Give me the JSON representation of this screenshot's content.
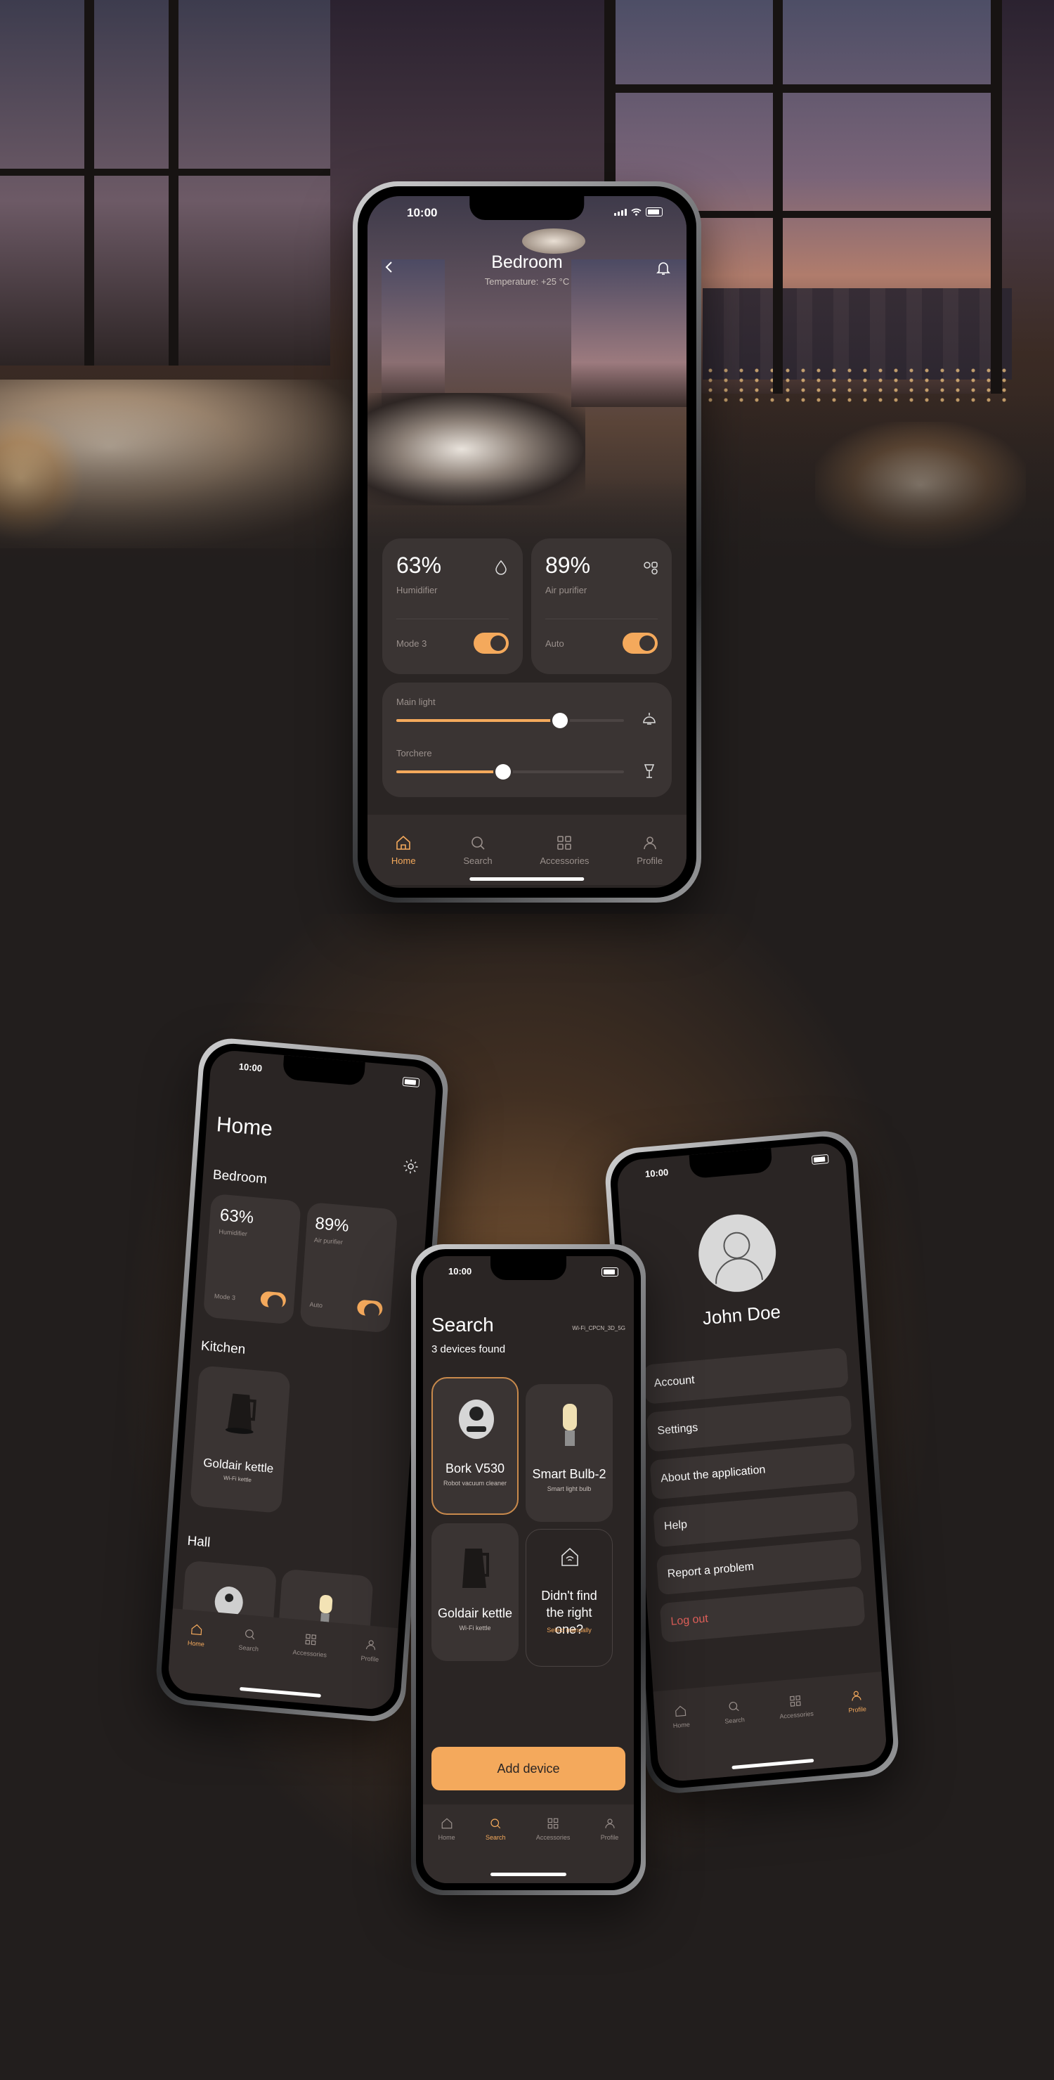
{
  "colors": {
    "accent": "#f4a95c",
    "background": "#221e1d",
    "card": "#3a3433",
    "danger": "#e0605a"
  },
  "status_time": "10:00",
  "main": {
    "title": "Bedroom",
    "subtitle": "Temperature: +25 °C",
    "humidifier": {
      "value": "63%",
      "label": "Humidifier",
      "mode": "Mode 3",
      "on": true,
      "icon": "droplet-icon"
    },
    "purifier": {
      "value": "89%",
      "label": "Air purifier",
      "mode": "Auto",
      "on": true,
      "icon": "air-purifier-icon"
    },
    "main_light": {
      "label": "Main light",
      "level": 0.72,
      "icon": "ceiling-lamp-icon"
    },
    "torchere": {
      "label": "Torchere",
      "level": 0.47,
      "icon": "floor-lamp-icon"
    }
  },
  "tabs": [
    {
      "label": "Home",
      "icon": "home-icon"
    },
    {
      "label": "Search",
      "icon": "search-icon"
    },
    {
      "label": "Accessories",
      "icon": "grid-icon"
    },
    {
      "label": "Profile",
      "icon": "profile-icon"
    }
  ],
  "home_screen": {
    "title": "Home",
    "bedroom_label": "Bedroom",
    "humidifier": {
      "value": "63%",
      "label": "Humidifier",
      "mode": "Mode 3"
    },
    "purifier": {
      "value": "89%",
      "label": "Air purifier",
      "mode": "Auto"
    },
    "kitchen_label": "Kitchen",
    "kettle": {
      "name": "Goldair kettle",
      "sub": "Wi-Fi kettle"
    },
    "hall_label": "Hall"
  },
  "search_screen": {
    "title": "Search",
    "wifi_info": "Wi-Fi_CPCN_3D_5G",
    "found": "3 devices found",
    "devices": [
      {
        "name": "Bork V530",
        "sub": "Robot vacuum cleaner"
      },
      {
        "name": "Smart Bulb-2",
        "sub": "Smart light bulb"
      },
      {
        "name": "Goldair kettle",
        "sub": "Wi-Fi kettle"
      }
    ],
    "not_found_title": "Didn't find the right one?",
    "not_found_link": "Select manually",
    "add_button": "Add device"
  },
  "profile_screen": {
    "name": "John Doe",
    "menu": [
      "Account",
      "Settings",
      "About the application",
      "Help",
      "Report a problem"
    ],
    "logout": "Log out"
  }
}
